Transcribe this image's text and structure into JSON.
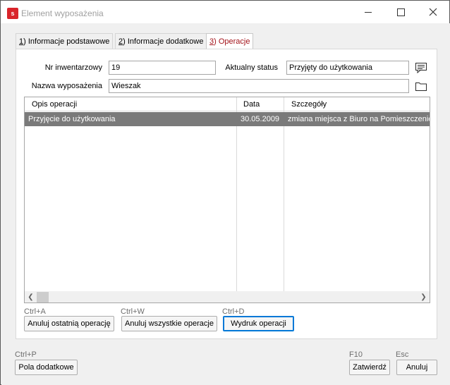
{
  "window": {
    "title": "Element wyposażenia",
    "app_icon_letter": "s",
    "minimize_icon": "minimize-icon",
    "maximize_icon": "maximize-icon",
    "close_icon": "close-icon"
  },
  "tabs": [
    {
      "key": "1",
      "label": ") Informacje podstawowe"
    },
    {
      "key": "2",
      "label": ") Informacje dodatkowe"
    },
    {
      "key": "3",
      "label": ") Operacje",
      "active": true
    }
  ],
  "form": {
    "inventory_label": "Nr inwentarzowy",
    "inventory_value": "19",
    "status_label": "Aktualny status",
    "status_value": "Przyjęty do użytkowania",
    "name_label": "Nazwa wyposażenia",
    "name_value": "Wieszak",
    "comment_icon": "comment-icon",
    "folder_icon": "folder-icon"
  },
  "grid": {
    "columns": [
      "Opis operacji",
      "Data",
      "Szczegóły"
    ],
    "rows": [
      {
        "description": "Przyjęcie do użytkowania",
        "date": "30.05.2009",
        "details": "zmiana miejsca z Biuro na Pomieszczenie"
      }
    ]
  },
  "actions": {
    "undo_last_shortcut": "Ctrl+A",
    "undo_last_label": "Anuluj ostatnią operację",
    "undo_all_shortcut": "Ctrl+W",
    "undo_all_label": "Anuluj wszystkie operacje",
    "print_shortcut": "Ctrl+D",
    "print_label": "Wydruk operacji"
  },
  "footer": {
    "extra_fields_shortcut": "Ctrl+P",
    "extra_fields_label": "Pola dodatkowe",
    "confirm_shortcut": "F10",
    "confirm_label": "Zatwierdź",
    "cancel_shortcut": "Esc",
    "cancel_label": "Anuluj"
  },
  "colors": {
    "accent_red": "#d9242a",
    "active_tab_text": "#a3131a",
    "selected_row": "#7a7a7a",
    "focus_border": "#0078d7"
  }
}
